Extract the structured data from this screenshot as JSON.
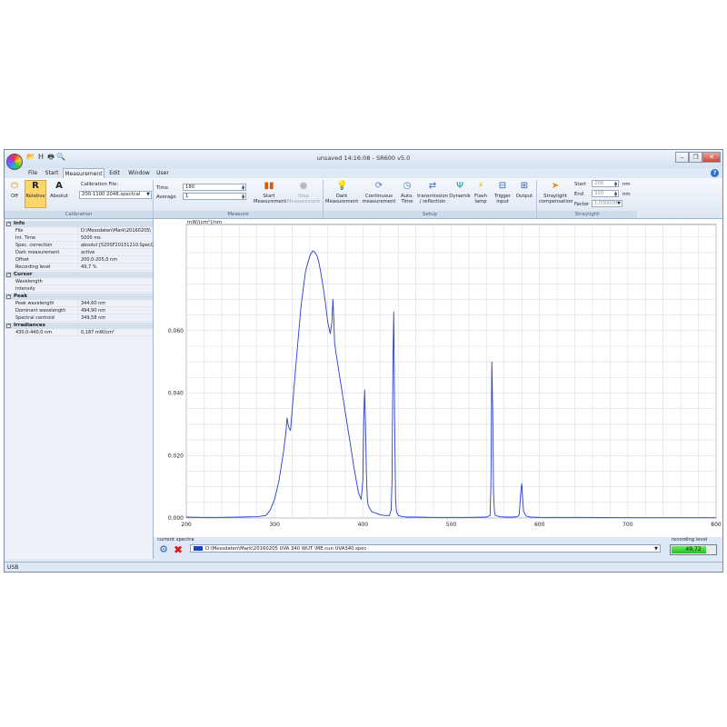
{
  "window": {
    "title": "unsaved 14:16:08 - SR600 v5.0",
    "controls": {
      "minimize": "–",
      "restore": "❐",
      "close": "✕"
    }
  },
  "quick_access": [
    {
      "icon": "open-folder-icon",
      "glyph": "📂"
    },
    {
      "icon": "save-icon",
      "glyph": "H"
    },
    {
      "icon": "print-icon",
      "glyph": "🖶"
    },
    {
      "icon": "preview-icon",
      "glyph": "🔍"
    }
  ],
  "menu": {
    "tabs": [
      "File",
      "Start",
      "Measurement",
      "Edit",
      "Window",
      "User"
    ],
    "active": "Measurement",
    "help": "?"
  },
  "ribbon": {
    "calibration": {
      "label": "Calibration",
      "buttons": [
        {
          "label": "Off",
          "icon": "off-icon"
        },
        {
          "label": "Relative",
          "icon": "relative-icon"
        },
        {
          "label": "Absolut",
          "icon": "absolut-icon"
        }
      ],
      "file_label": "Calibration File:",
      "file_value": "200-1100 2048.spectcal"
    },
    "measure": {
      "label": "Measure",
      "time_label": "Time",
      "time_value": "180",
      "average_label": "Average",
      "average_value": "1",
      "start_label": "Start Measurement",
      "stop_label": "Stop Measurement"
    },
    "setup": {
      "label": "Setup",
      "buttons": [
        {
          "label": "Dark Measurement",
          "icon": "dark-bulb-icon"
        },
        {
          "label": "Continuous measurement",
          "icon": "continuous-icon"
        },
        {
          "label": "Auto. Time",
          "icon": "clock-icon"
        },
        {
          "label": "transmission / reflection",
          "icon": "transmission-icon"
        },
        {
          "label": "Dynamik",
          "icon": "dynamik-icon"
        },
        {
          "label": "Flash lamp",
          "icon": "flash-icon"
        },
        {
          "label": "Trigger input",
          "icon": "trigger-icon"
        },
        {
          "label": "Output",
          "icon": "output-icon"
        }
      ]
    },
    "straylight": {
      "label": "Straylight",
      "button": "Straylight compensation",
      "start_label": "Start",
      "start_value": "200",
      "end_label": "End",
      "end_value": "320",
      "factor_label": "Factor",
      "factor_value": "1,000000",
      "unit": "nm"
    }
  },
  "panel": {
    "sections": [
      {
        "title": "Info",
        "rows": [
          {
            "k": "File",
            "v": "D:\\Messdaten\\Mark\\20160205\\"
          },
          {
            "k": "Int. Time",
            "v": "5000 ms"
          },
          {
            "k": "Spec. correction",
            "v": "absolut [520SF20151210.SpecC"
          },
          {
            "k": "Dark measurement",
            "v": "active"
          },
          {
            "k": "Offset",
            "v": "200,0-205,0 nm"
          },
          {
            "k": "Recording level",
            "v": "49,7 %"
          }
        ]
      },
      {
        "title": "Cursor",
        "rows": [
          {
            "k": "Wavelength",
            "v": ""
          },
          {
            "k": "Intensity",
            "v": ""
          }
        ]
      },
      {
        "title": "Peak",
        "rows": [
          {
            "k": "Peak wavelength",
            "v": "344,60 nm"
          },
          {
            "k": "Dominant wavelength",
            "v": "494,90 nm"
          },
          {
            "k": "Spectral centroid",
            "v": "349,58 nm"
          }
        ]
      },
      {
        "title": "Irradiances",
        "rows": [
          {
            "k": "430,0-440,0 nm",
            "v": "0,187 mW/cm²"
          }
        ]
      }
    ]
  },
  "chart_data": {
    "type": "line",
    "ylabel": "mW/(cm²)/nm",
    "xlim": [
      200,
      800
    ],
    "ylim": [
      0,
      0.094
    ],
    "x_ticks": [
      "200",
      "300",
      "400",
      "500",
      "600",
      "700",
      "800"
    ],
    "y_ticks": [
      {
        "v": 0.0,
        "label": "0.000"
      },
      {
        "v": 0.02,
        "label": "0.020"
      },
      {
        "v": 0.04,
        "label": "0.040"
      },
      {
        "v": 0.06,
        "label": "0.060"
      }
    ],
    "grid": true,
    "series_color": "#2a3bd6",
    "series": [
      {
        "x": [
          200,
          220,
          240,
          260,
          280,
          290,
          295,
          300,
          305,
          310,
          313,
          314,
          316,
          318,
          320,
          325,
          330,
          335,
          340,
          343,
          345,
          348,
          350,
          352,
          355,
          358,
          360,
          363,
          365,
          366,
          367,
          368,
          370,
          375,
          380,
          385,
          390,
          395,
          398,
          400,
          401,
          402,
          403,
          404,
          405,
          406,
          408,
          410,
          415,
          420,
          425,
          430,
          432,
          433,
          434,
          435,
          436,
          437,
          438,
          440,
          445,
          450,
          460,
          480,
          500,
          520,
          540,
          544,
          545,
          546,
          547,
          548,
          549,
          550,
          555,
          560,
          570,
          575,
          577,
          578,
          579,
          580,
          581,
          582,
          585,
          590,
          600,
          650,
          700,
          750,
          800
        ],
        "y": [
          0.0003,
          0.0002,
          0.0002,
          0.0003,
          0.0004,
          0.0008,
          0.0025,
          0.006,
          0.012,
          0.021,
          0.028,
          0.032,
          0.029,
          0.028,
          0.035,
          0.052,
          0.068,
          0.079,
          0.084,
          0.0855,
          0.0853,
          0.084,
          0.082,
          0.079,
          0.074,
          0.068,
          0.063,
          0.059,
          0.063,
          0.07,
          0.064,
          0.056,
          0.052,
          0.043,
          0.034,
          0.025,
          0.016,
          0.008,
          0.006,
          0.012,
          0.032,
          0.041,
          0.03,
          0.014,
          0.006,
          0.004,
          0.003,
          0.002,
          0.0015,
          0.001,
          0.0008,
          0.0008,
          0.0025,
          0.012,
          0.05,
          0.066,
          0.03,
          0.006,
          0.002,
          0.0008,
          0.0004,
          0.0003,
          0.0003,
          0.0002,
          0.0002,
          0.0002,
          0.0003,
          0.0008,
          0.01,
          0.05,
          0.034,
          0.008,
          0.002,
          0.0008,
          0.0004,
          0.0003,
          0.0003,
          0.0004,
          0.001,
          0.005,
          0.009,
          0.011,
          0.006,
          0.002,
          0.0006,
          0.0003,
          0.0002,
          0.0002,
          0.0001,
          0.0001,
          0.0001
        ]
      }
    ]
  },
  "current_spectra": {
    "label": "current spectra",
    "value": "D:\\Messdaten\\Mark\\20160205 UVA 340 WUT \\ME.cun UVA340.spec",
    "recording_label": "recording level",
    "recording_value": "49,72",
    "recording_fraction": 0.497,
    "swatch_color": "#1f3fc7"
  },
  "status": "USB"
}
